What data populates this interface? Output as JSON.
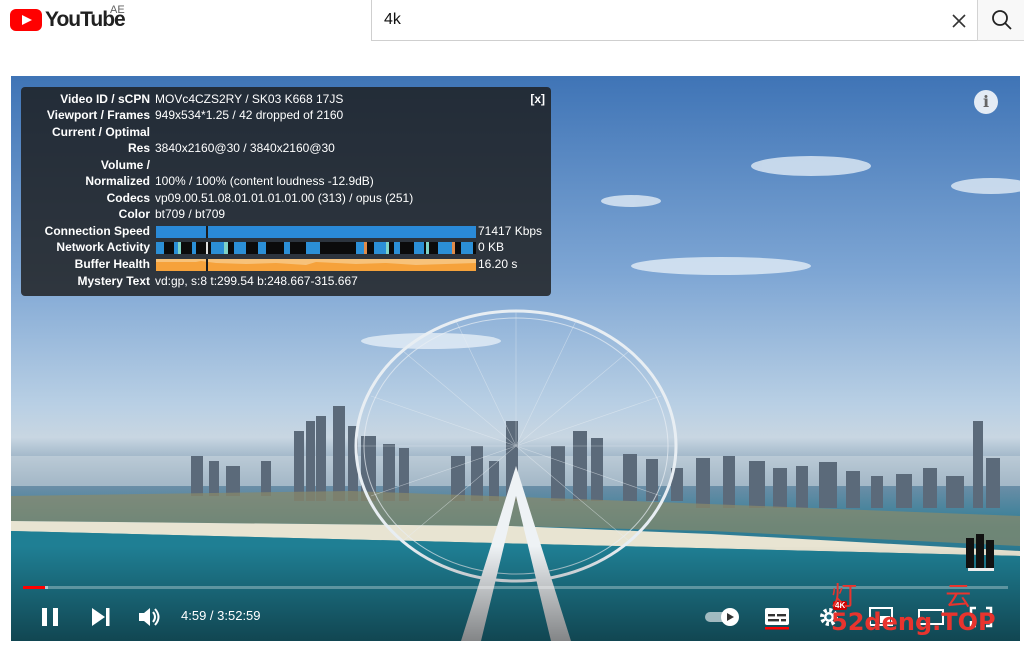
{
  "header": {
    "logo_text": "YouTube",
    "country_code": "AE",
    "search_value": "4k"
  },
  "player": {
    "stats": {
      "close_label": "[x]",
      "rows": [
        {
          "key": "Video ID / sCPN",
          "value": "MOVc4CZS2RY / SK03 K668 17JS"
        },
        {
          "key": "Viewport / Frames",
          "value": "949x534*1.25 / 42 dropped of 2160"
        },
        {
          "key": "Current / Optimal",
          "value": ""
        },
        {
          "key": "Res",
          "value": "3840x2160@30 / 3840x2160@30"
        },
        {
          "key": "Volume /",
          "value": ""
        },
        {
          "key": "Normalized",
          "value": "100% / 100% (content loudness -12.9dB)"
        },
        {
          "key": "Codecs",
          "value": "vp09.00.51.08.01.01.01.01.00 (313) / opus (251)"
        },
        {
          "key": "Color",
          "value": "bt709 / bt709"
        }
      ],
      "graphs": [
        {
          "key": "Connection Speed",
          "value": "71417 Kbps"
        },
        {
          "key": "Network Activity",
          "value": "0 KB"
        },
        {
          "key": "Buffer Health",
          "value": "16.20 s"
        }
      ],
      "mystery": {
        "key": "Mystery Text",
        "value": "vd:gp, s:8 t:299.54 b:248.667-315.667"
      }
    },
    "info_icon": "i",
    "time_display": "4:59 / 3:52:59",
    "progress_played": 0.022,
    "progress_buffered": 0.025,
    "quality_badge": "4K",
    "watermark": {
      "top": "灯 云",
      "bottom": "52deng.TOP"
    },
    "colors": {
      "brand_red": "#ff0000",
      "stats_bg": "#1c1c1c",
      "connection_bar": "#2a8ad8",
      "buffer_bar": "#f6a23b"
    }
  }
}
